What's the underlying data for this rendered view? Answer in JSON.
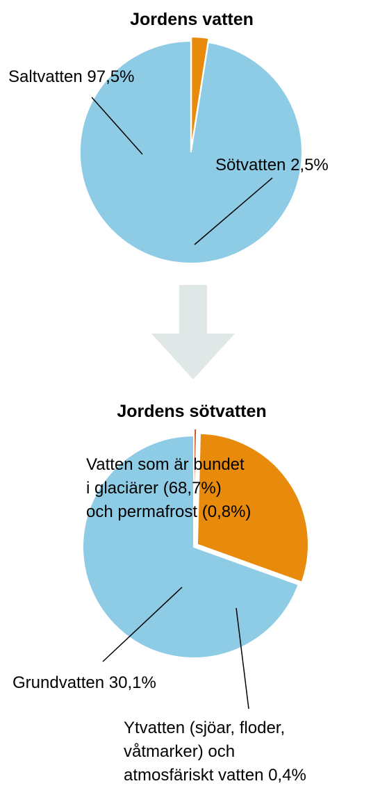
{
  "chart_data": [
    {
      "type": "pie",
      "title": "Jordens vatten",
      "slices": [
        {
          "label": "Saltvatten 97,5%",
          "value": 97.5,
          "color": "#8ecbe5"
        },
        {
          "label": "Sötvatten 2,5%",
          "value": 2.5,
          "color": "#e88a0c"
        }
      ]
    },
    {
      "type": "pie",
      "title": "Jordens sötvatten",
      "slices": [
        {
          "label": [
            "Vatten som är bundet",
            "i glaciärer (68,7%)",
            "och permafrost (0,8%)"
          ],
          "value": 69.5,
          "color": "#8ecbe5"
        },
        {
          "label": "Grundvatten 30,1%",
          "value": 30.1,
          "color": "#e88a0c"
        },
        {
          "label": [
            "Ytvatten (sjöar, floder,",
            "våtmarker) och",
            "atmosfäriskt vatten 0,4%"
          ],
          "value": 0.4,
          "color": "#c0531a"
        }
      ]
    }
  ],
  "arrow": {
    "color": "#dfe8e6"
  }
}
